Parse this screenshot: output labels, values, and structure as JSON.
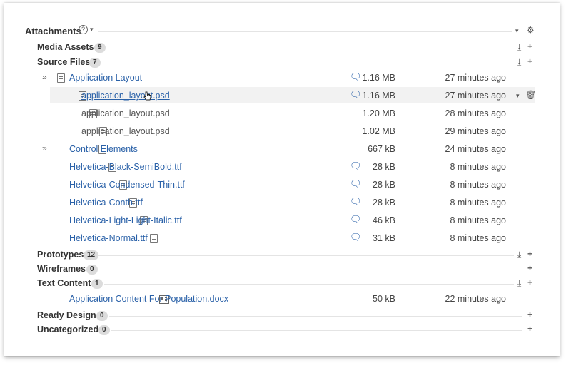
{
  "header": {
    "title": "Attachments",
    "help_icon": "question-circle-icon"
  },
  "sections": [
    {
      "name": "Media Assets",
      "count": "9"
    },
    {
      "name": "Source Files",
      "count": "7"
    },
    {
      "name": "Prototypes",
      "count": "12"
    },
    {
      "name": "Wireframes",
      "count": "0"
    },
    {
      "name": "Text Content",
      "count": "1"
    },
    {
      "name": "Ready Design",
      "count": "0"
    },
    {
      "name": "Uncategorized",
      "count": "0"
    }
  ],
  "source_files": [
    {
      "name": "Application Layout",
      "size": "1.16 MB",
      "time": "27 minutes ago",
      "toggle": "»",
      "comment": true
    },
    {
      "name": "application_layout.psd",
      "size": "1.16 MB",
      "time": "27 minutes ago",
      "comment": true
    },
    {
      "name": "application_layout.psd",
      "size": "1.20 MB",
      "time": "28 minutes ago"
    },
    {
      "name": "application_layout.psd",
      "size": "1.02 MB",
      "time": "29 minutes ago"
    },
    {
      "name": "Control Elements",
      "size": "667 kB",
      "time": "24 minutes ago",
      "toggle": "»"
    },
    {
      "name": "Helvetica-Black-SemiBold.ttf",
      "size": "28 kB",
      "time": "8 minutes ago",
      "comment": true
    },
    {
      "name": "Helvetica-Condensed-Thin.ttf",
      "size": "28 kB",
      "time": "8 minutes ago",
      "comment": true
    },
    {
      "name": "Helvetica-Conth.ttf",
      "size": "28 kB",
      "time": "8 minutes ago",
      "comment": true
    },
    {
      "name": "Helvetica-Light-Light-Italic.ttf",
      "size": "46 kB",
      "time": "8 minutes ago",
      "comment": true
    },
    {
      "name": "Helvetica-Normal.ttf",
      "size": "31 kB",
      "time": "8 minutes ago",
      "comment": true
    }
  ],
  "text_content": [
    {
      "name": "Application Content For Population.docx",
      "size": "50 kB",
      "time": "22 minutes ago"
    }
  ]
}
